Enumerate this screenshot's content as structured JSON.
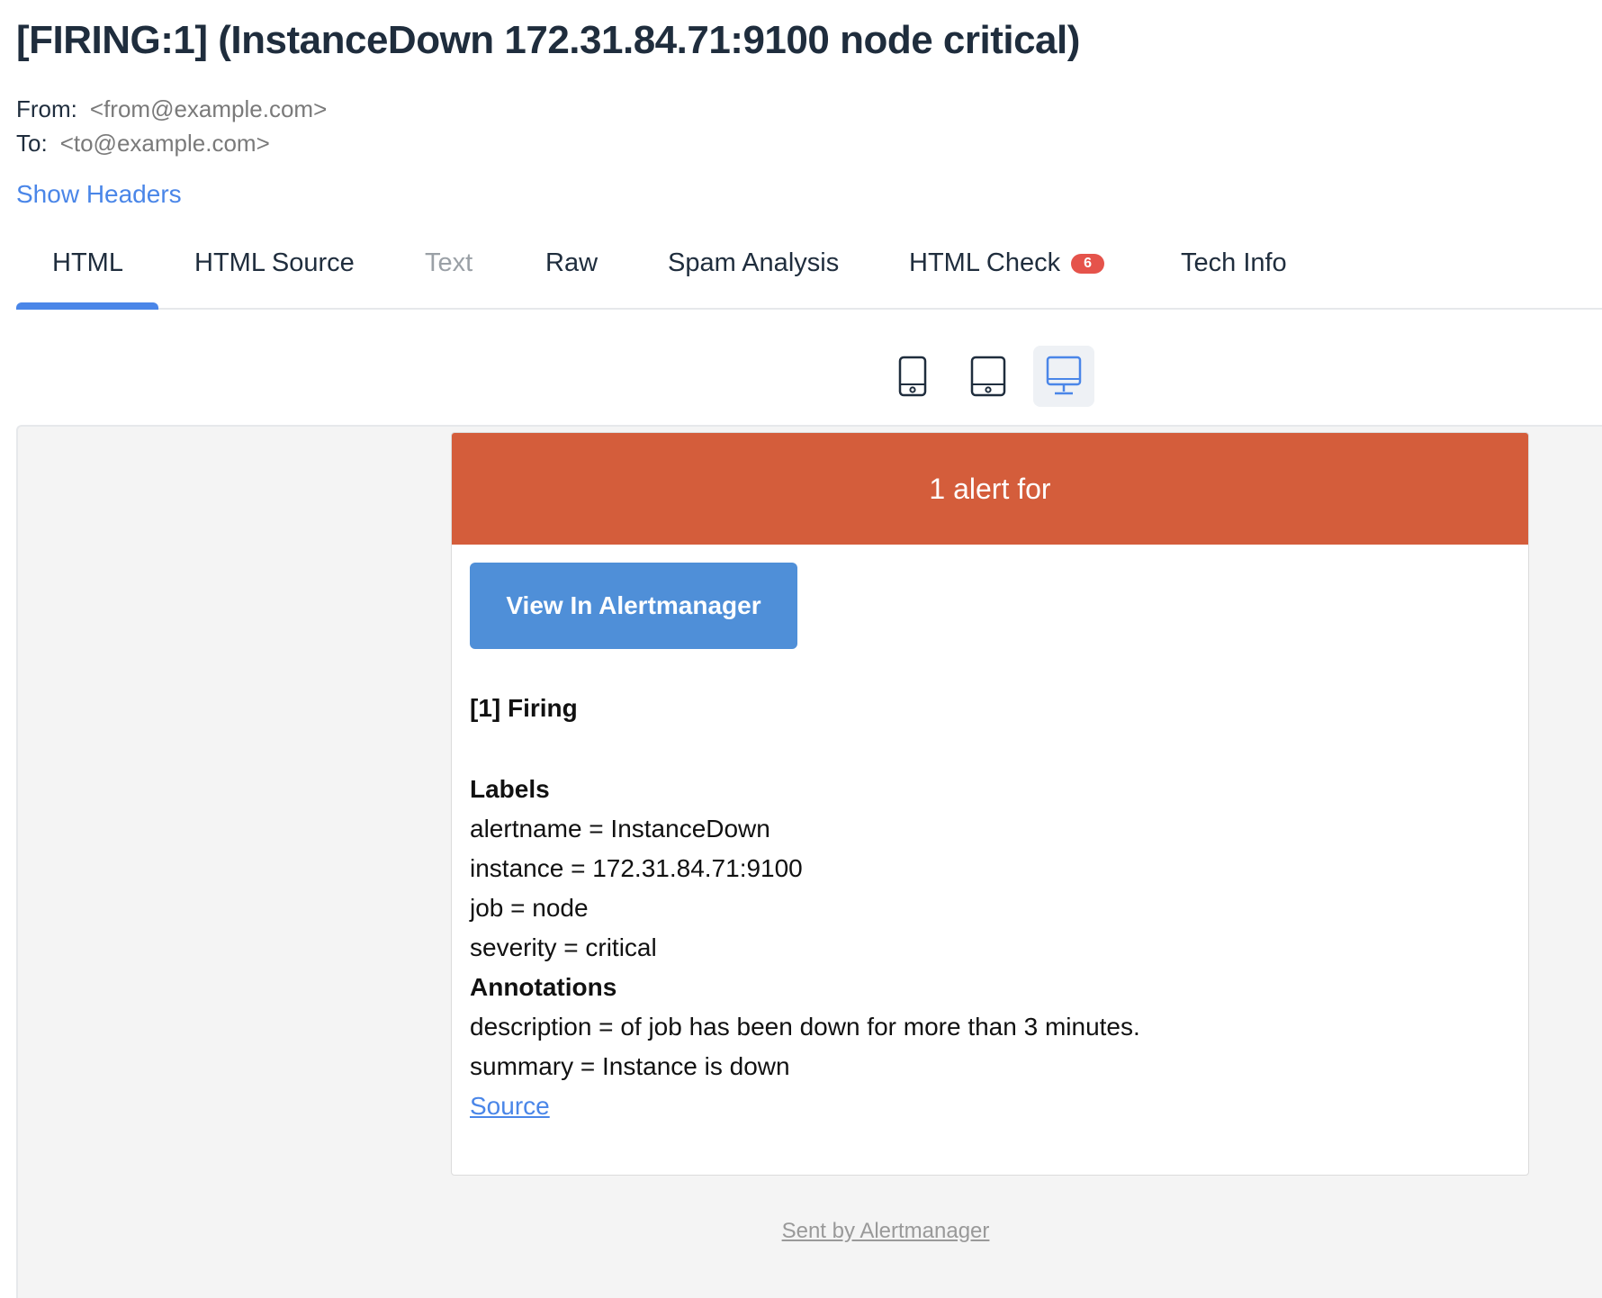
{
  "email": {
    "subject": "[FIRING:1] (InstanceDown 172.31.84.71:9100 node critical)",
    "from_label": "From:",
    "from_value": "<from@example.com>",
    "to_label": "To:",
    "to_value": "<to@example.com>",
    "show_headers": "Show Headers"
  },
  "tabs": [
    {
      "label": "HTML",
      "active": true
    },
    {
      "label": "HTML Source"
    },
    {
      "label": "Text",
      "disabled": true
    },
    {
      "label": "Raw"
    },
    {
      "label": "Spam Analysis"
    },
    {
      "label": "HTML Check",
      "badge": "6"
    },
    {
      "label": "Tech Info"
    }
  ],
  "devices": [
    {
      "icon": "mobile-device-icon"
    },
    {
      "icon": "tablet-device-icon"
    },
    {
      "icon": "desktop-device-icon",
      "active": true
    }
  ],
  "preview": {
    "header_title": "1 alert for",
    "view_button": "View In Alertmanager",
    "firing_heading": "[1] Firing",
    "labels_heading": "Labels",
    "labels": [
      "alertname = InstanceDown",
      "instance = 172.31.84.71:9100",
      "job = node",
      "severity = critical"
    ],
    "annotations_heading": "Annotations",
    "annotations": [
      "description = of job has been down for more than 3 minutes.",
      "summary = Instance is down"
    ],
    "source_link": "Source",
    "footer_link": "Sent by Alertmanager"
  },
  "colors": {
    "header_bg": "#d45d3b",
    "button_bg": "#4f8fd8",
    "link": "#4a86e8",
    "badge": "#e5534b"
  }
}
